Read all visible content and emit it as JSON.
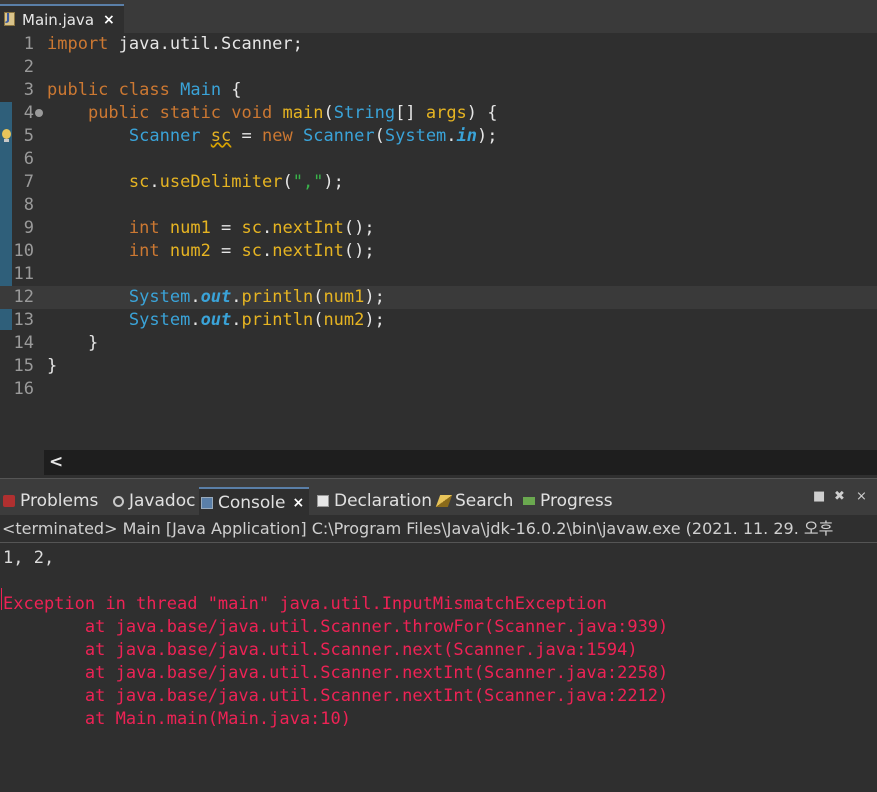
{
  "editor": {
    "tab": {
      "label": "Main.java",
      "close": "×"
    },
    "lines": [
      {
        "n": "1",
        "tokens": [
          {
            "t": "import",
            "c": "kw"
          },
          {
            "t": " java.util.Scanner;",
            "c": "plain"
          }
        ]
      },
      {
        "n": "2",
        "tokens": []
      },
      {
        "n": "3",
        "tokens": [
          {
            "t": "public",
            "c": "kw"
          },
          {
            "t": " ",
            "c": "plain"
          },
          {
            "t": "class",
            "c": "kw"
          },
          {
            "t": " ",
            "c": "plain"
          },
          {
            "t": "Main",
            "c": "cls"
          },
          {
            "t": " {",
            "c": "plain"
          }
        ]
      },
      {
        "n": "4",
        "fold": true,
        "tokens": [
          {
            "t": "    ",
            "c": "plain"
          },
          {
            "t": "public",
            "c": "kw"
          },
          {
            "t": " ",
            "c": "plain"
          },
          {
            "t": "static",
            "c": "kw"
          },
          {
            "t": " ",
            "c": "plain"
          },
          {
            "t": "void",
            "c": "kw"
          },
          {
            "t": " ",
            "c": "plain"
          },
          {
            "t": "main",
            "c": "mth"
          },
          {
            "t": "(",
            "c": "plain"
          },
          {
            "t": "String",
            "c": "cls"
          },
          {
            "t": "[] ",
            "c": "plain"
          },
          {
            "t": "args",
            "c": "var"
          },
          {
            "t": ") {",
            "c": "plain"
          }
        ]
      },
      {
        "n": "5",
        "bulb": true,
        "tokens": [
          {
            "t": "        ",
            "c": "plain"
          },
          {
            "t": "Scanner",
            "c": "cls"
          },
          {
            "t": " ",
            "c": "plain"
          },
          {
            "t": "sc",
            "c": "var warn-underline"
          },
          {
            "t": " = ",
            "c": "plain"
          },
          {
            "t": "new",
            "c": "kw"
          },
          {
            "t": " ",
            "c": "plain"
          },
          {
            "t": "Scanner",
            "c": "cls"
          },
          {
            "t": "(",
            "c": "plain"
          },
          {
            "t": "System",
            "c": "cls"
          },
          {
            "t": ".",
            "c": "plain"
          },
          {
            "t": "in",
            "c": "fld"
          },
          {
            "t": ");",
            "c": "plain"
          }
        ]
      },
      {
        "n": "6",
        "tokens": []
      },
      {
        "n": "7",
        "tokens": [
          {
            "t": "        ",
            "c": "plain"
          },
          {
            "t": "sc",
            "c": "var"
          },
          {
            "t": ".",
            "c": "plain"
          },
          {
            "t": "useDelimiter",
            "c": "mth"
          },
          {
            "t": "(",
            "c": "plain"
          },
          {
            "t": "\",\"",
            "c": "str"
          },
          {
            "t": ");",
            "c": "plain"
          }
        ]
      },
      {
        "n": "8",
        "tokens": []
      },
      {
        "n": "9",
        "tokens": [
          {
            "t": "        ",
            "c": "plain"
          },
          {
            "t": "int",
            "c": "kw"
          },
          {
            "t": " ",
            "c": "plain"
          },
          {
            "t": "num1",
            "c": "var"
          },
          {
            "t": " = ",
            "c": "plain"
          },
          {
            "t": "sc",
            "c": "var"
          },
          {
            "t": ".",
            "c": "plain"
          },
          {
            "t": "nextInt",
            "c": "mth"
          },
          {
            "t": "();",
            "c": "plain"
          }
        ]
      },
      {
        "n": "10",
        "tokens": [
          {
            "t": "        ",
            "c": "plain"
          },
          {
            "t": "int",
            "c": "kw"
          },
          {
            "t": " ",
            "c": "plain"
          },
          {
            "t": "num2",
            "c": "var"
          },
          {
            "t": " = ",
            "c": "plain"
          },
          {
            "t": "sc",
            "c": "var"
          },
          {
            "t": ".",
            "c": "plain"
          },
          {
            "t": "nextInt",
            "c": "mth"
          },
          {
            "t": "();",
            "c": "plain"
          }
        ]
      },
      {
        "n": "11",
        "tokens": []
      },
      {
        "n": "12",
        "current": true,
        "tokens": [
          {
            "t": "        ",
            "c": "plain"
          },
          {
            "t": "System",
            "c": "cls"
          },
          {
            "t": ".",
            "c": "plain"
          },
          {
            "t": "out",
            "c": "fld"
          },
          {
            "t": ".",
            "c": "plain"
          },
          {
            "t": "println",
            "c": "mth"
          },
          {
            "t": "(",
            "c": "plain"
          },
          {
            "t": "num1",
            "c": "var"
          },
          {
            "t": ");",
            "c": "plain"
          }
        ]
      },
      {
        "n": "13",
        "tokens": [
          {
            "t": "        ",
            "c": "plain"
          },
          {
            "t": "System",
            "c": "cls"
          },
          {
            "t": ".",
            "c": "plain"
          },
          {
            "t": "out",
            "c": "fld"
          },
          {
            "t": ".",
            "c": "plain"
          },
          {
            "t": "println",
            "c": "mth"
          },
          {
            "t": "(",
            "c": "plain"
          },
          {
            "t": "num2",
            "c": "var"
          },
          {
            "t": ");",
            "c": "plain"
          }
        ]
      },
      {
        "n": "14",
        "tokens": [
          {
            "t": "    }",
            "c": "plain"
          }
        ]
      },
      {
        "n": "15",
        "tokens": [
          {
            "t": "}",
            "c": "plain"
          }
        ]
      },
      {
        "n": "16",
        "tokens": []
      }
    ]
  },
  "scrollbar": {
    "left_arrow": "<"
  },
  "views": {
    "problems": "Problems",
    "javadoc": "Javadoc",
    "console": "Console",
    "console_close": "×",
    "declaration": "Declaration",
    "search": "Search",
    "progress": "Progress",
    "controls": [
      "■",
      "✖",
      "⨯"
    ]
  },
  "console": {
    "header": "<terminated> Main [Java Application] C:\\Program Files\\Java\\jdk-16.0.2\\bin\\javaw.exe  (2021. 11. 29. 오후",
    "lines": [
      {
        "text": "1, 2,",
        "kind": "out"
      },
      {
        "text": "",
        "kind": "out"
      },
      {
        "text": "Exception in thread \"main\" java.util.InputMismatchException",
        "kind": "err"
      },
      {
        "text": "\tat java.base/java.util.Scanner.throwFor(Scanner.java:939)",
        "kind": "err"
      },
      {
        "text": "\tat java.base/java.util.Scanner.next(Scanner.java:1594)",
        "kind": "err"
      },
      {
        "text": "\tat java.base/java.util.Scanner.nextInt(Scanner.java:2258)",
        "kind": "err"
      },
      {
        "text": "\tat java.base/java.util.Scanner.nextInt(Scanner.java:2212)",
        "kind": "err"
      },
      {
        "text": "\tat Main.main(Main.java:10)",
        "kind": "err"
      }
    ]
  }
}
